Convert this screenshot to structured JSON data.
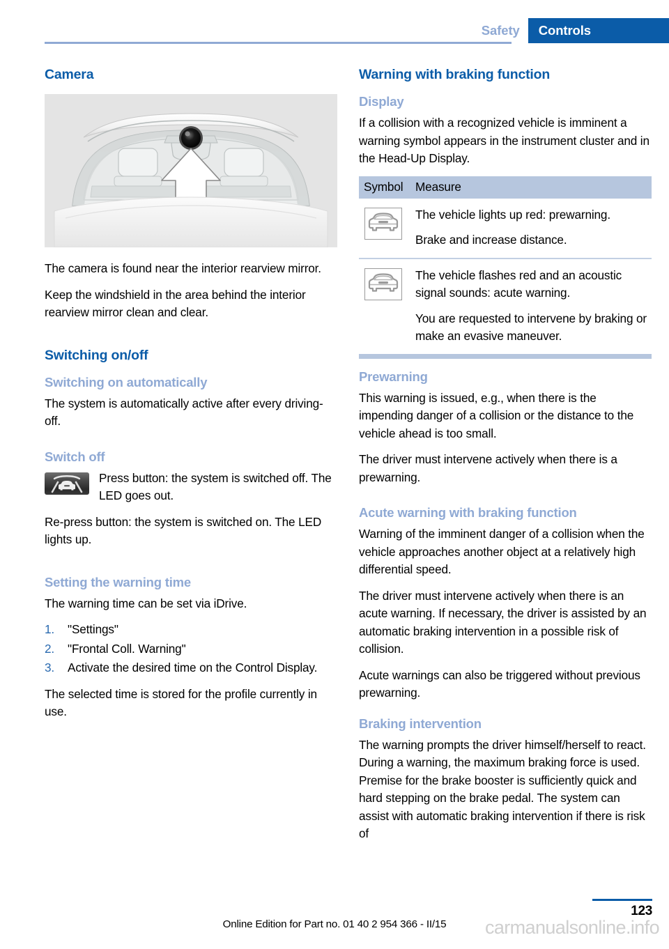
{
  "header": {
    "breadcrumb_inactive": "Safety",
    "breadcrumb_active": "Controls",
    "accent_blue": "#0b5ca8",
    "muted_blue": "#8fa9d4"
  },
  "left_column": {
    "heading": "Camera",
    "figure": {
      "name": "windshield-camera-illustration",
      "alt": "View of vehicle interior through windshield with arrow pointing to camera near the rearview mirror"
    },
    "paragraphs_after_figure": [
      "The camera is found near the interior rearview mirror.",
      "Keep the windshield in the area behind the interior rearview mirror clean and clear."
    ],
    "switching_heading": "Switching on/off",
    "auto_sub": "Switching on automatically",
    "auto_text": "The system is automatically active after every driving-off.",
    "switch_off_sub": "Switch off",
    "switch_off_icon_name": "collision-warning-button-icon",
    "switch_off_icon_text": "Press button: the system is switched off. The LED goes out.",
    "switch_off_text": "Re-press button: the system is switched on. The LED lights up.",
    "warning_time_sub": "Setting the warning time",
    "warning_time_intro": "The warning time can be set via iDrive.",
    "steps": [
      {
        "num": "1.",
        "text": "\"Settings\""
      },
      {
        "num": "2.",
        "text": "\"Frontal Coll. Warning\""
      },
      {
        "num": "3.",
        "text": "Activate the desired time on the Control Display."
      }
    ],
    "warning_time_outro": "The selected time is stored for the profile currently in use."
  },
  "right_column": {
    "heading": "Warning with braking function",
    "display_sub": "Display",
    "display_text": "If a collision with a recognized vehicle is imminent a warning symbol appears in the instrument cluster and in the Head-Up Display.",
    "table": {
      "columns": [
        "Symbol",
        "Measure"
      ],
      "rows": [
        {
          "symbol_name": "car-front-warning-symbol",
          "measures": [
            "The vehicle lights up red: prewarning.",
            "Brake and increase distance."
          ]
        },
        {
          "symbol_name": "car-front-warning-symbol",
          "measures": [
            "The vehicle flashes red and an acoustic signal sounds: acute warning.",
            "You are requested to intervene by braking or make an evasive maneuver."
          ]
        }
      ]
    },
    "prewarning_sub": "Prewarning",
    "prewarning_p1": "This warning is issued, e.g., when there is the impending danger of a collision or the distance to the vehicle ahead is too small.",
    "prewarning_p2": "The driver must intervene actively when there is a prewarning.",
    "acute_sub": "Acute warning with braking function",
    "acute_p1": "Warning of the imminent danger of a collision when the vehicle approaches another object at a relatively high differential speed.",
    "acute_p2": "The driver must intervene actively when there is an acute warning. If necessary, the driver is assisted by an automatic braking intervention in a possible risk of collision.",
    "acute_p3": "Acute warnings can also be triggered without previous prewarning.",
    "braking_sub": "Braking intervention",
    "braking_p1": "The warning prompts the driver himself/herself to react. During a warning, the maximum braking force is used. Premise for the brake booster is sufficiently quick and hard stepping on the brake pedal. The system can assist with automatic braking intervention if there is risk of"
  },
  "footer": {
    "online_edition": "Online Edition for Part no. 01 40 2 954 366 - II/15",
    "page_number": "123",
    "watermark": "carmanualsonline.info"
  }
}
